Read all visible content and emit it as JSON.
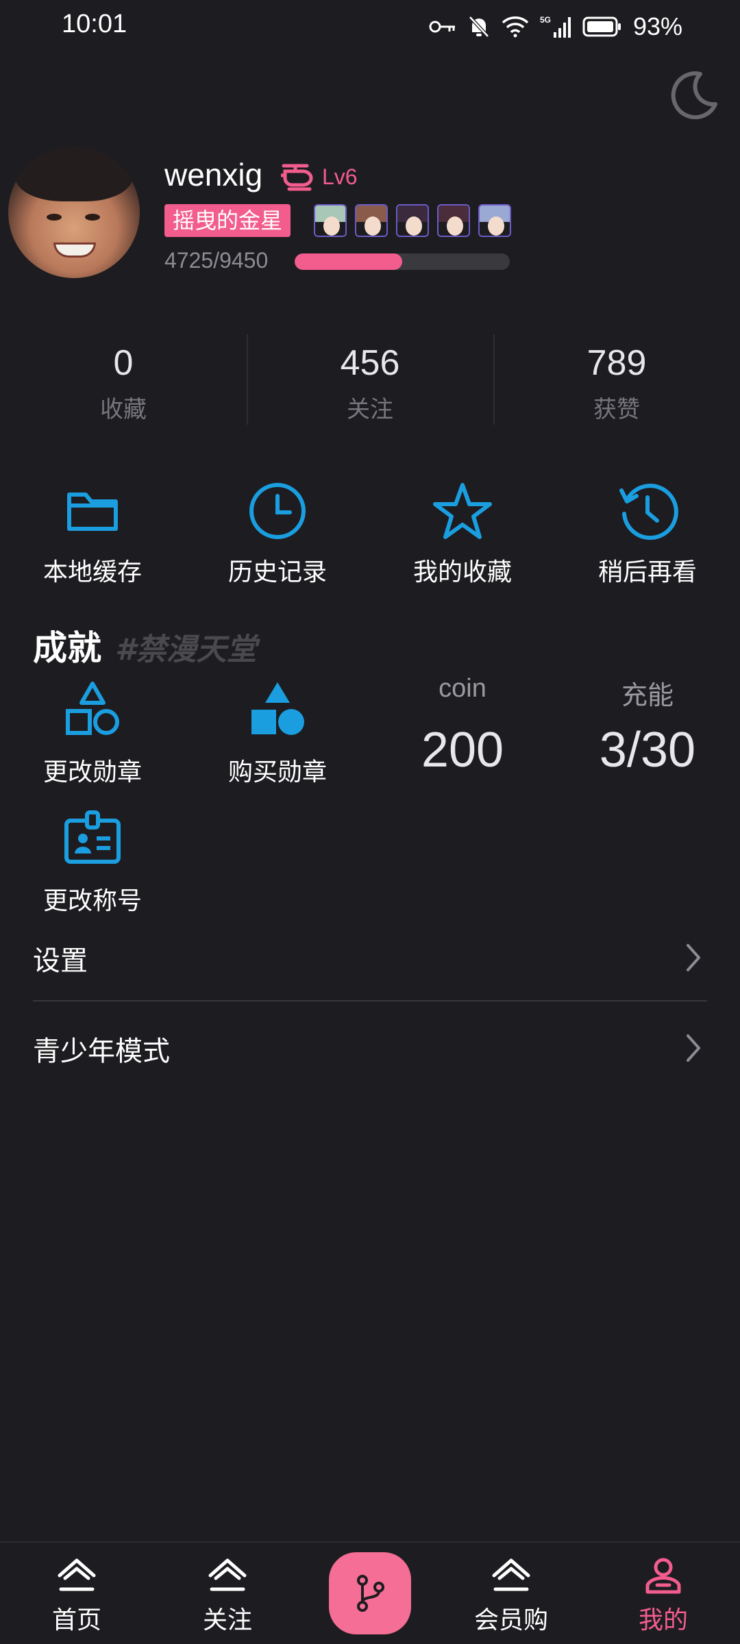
{
  "status_bar": {
    "time": "10:01",
    "battery": "93%",
    "icons": [
      "key-icon",
      "bell-muted-icon",
      "wifi-icon",
      "signal-5g-icon",
      "battery-icon"
    ]
  },
  "theme_toggle": {
    "icon": "moon-icon"
  },
  "profile": {
    "username": "wenxig",
    "vehicle_icon": "helicopter-icon",
    "level": "Lv6",
    "title": "摇曳的金星",
    "exp_text": "4725/9450",
    "exp_progress": 0.5,
    "badge_avatars": 5
  },
  "stats": [
    {
      "value": "0",
      "label": "收藏"
    },
    {
      "value": "456",
      "label": "关注"
    },
    {
      "value": "789",
      "label": "获赞"
    }
  ],
  "quick_actions": [
    {
      "label": "本地缓存",
      "icon": "folder-icon"
    },
    {
      "label": "历史记录",
      "icon": "clock-icon"
    },
    {
      "label": "我的收藏",
      "icon": "star-icon"
    },
    {
      "label": "稍后再看",
      "icon": "history-icon"
    }
  ],
  "achievements": {
    "title": "成就",
    "subtitle": "#禁漫天堂",
    "change_badge": "更改勋章",
    "buy_badge": "购买勋章",
    "coin_label": "coin",
    "coin_value": "200",
    "charge_label": "充能",
    "charge_value": "3/30",
    "change_title": "更改称号"
  },
  "settings": {
    "settings_label": "设置",
    "youth_mode_label": "青少年模式"
  },
  "bottom_nav": {
    "home": "首页",
    "follow": "关注",
    "vip_shop": "会员购",
    "mine": "我的"
  },
  "colors": {
    "accent": "#f25d8e",
    "icon_blue": "#1a9ee0",
    "background": "#1d1c20"
  }
}
